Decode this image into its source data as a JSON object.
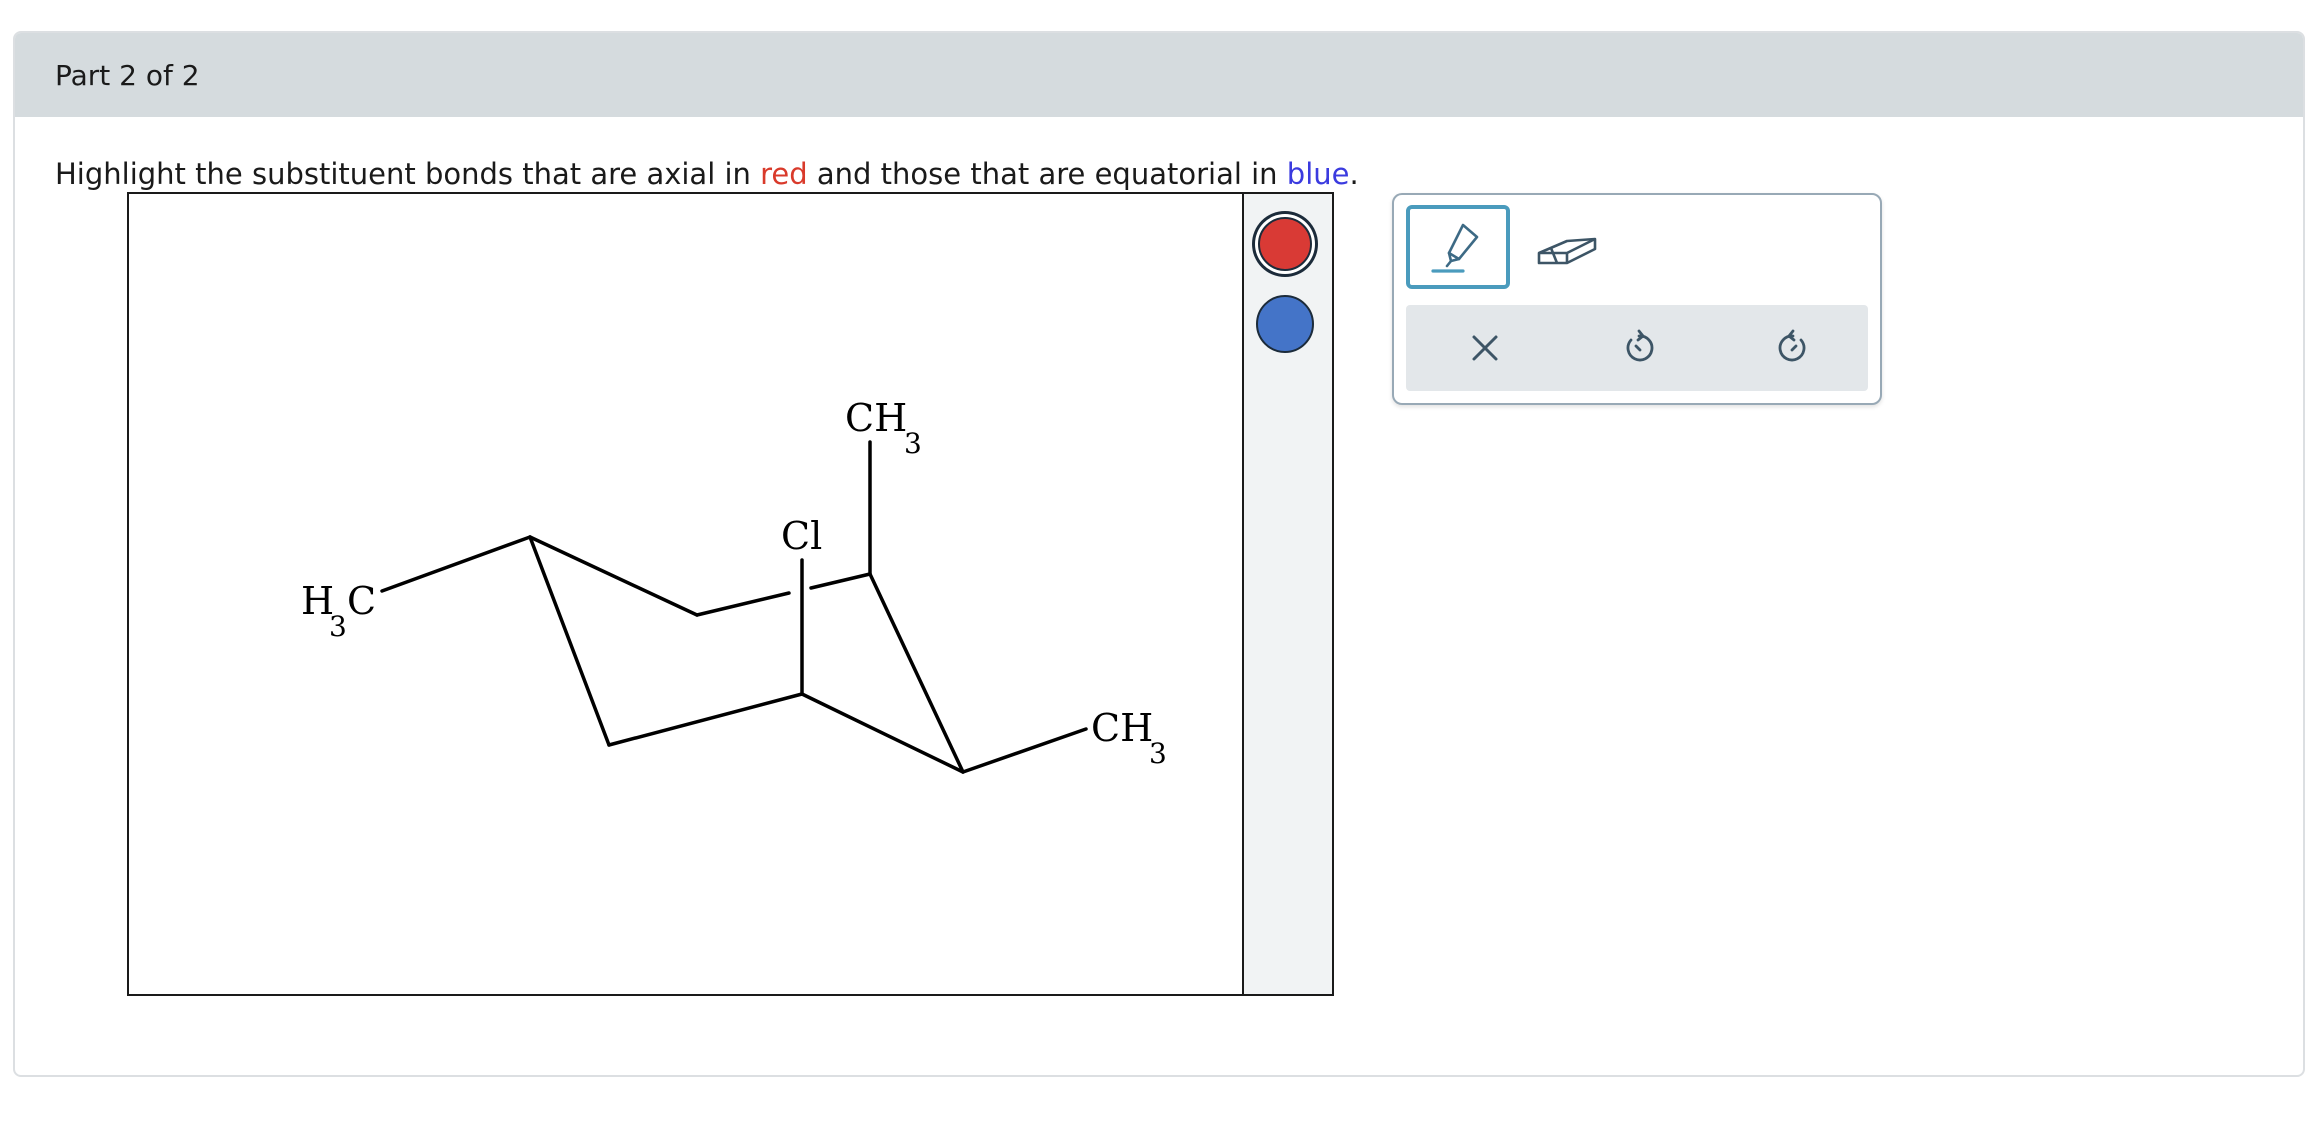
{
  "header": {
    "part_label": "Part 2 of 2"
  },
  "instruction": {
    "before": "Highlight the substituent bonds that are axial in ",
    "red_word": "red",
    "middle": " and those that are equatorial in ",
    "blue_word": "blue",
    "end": "."
  },
  "molecule": {
    "labels": {
      "h3c_h": "H",
      "h3c_sub": "3",
      "h3c_c": "C",
      "cl": "Cl",
      "ch3_top_main": "CH",
      "ch3_top_sub": "3",
      "ch3_right_main": "CH",
      "ch3_right_sub": "3"
    }
  },
  "color_picker": {
    "swatches": [
      {
        "name": "red",
        "color": "#d93a35",
        "selected": true
      },
      {
        "name": "blue",
        "color": "#4474c8",
        "selected": false
      }
    ]
  },
  "tools": {
    "pencil": {
      "icon": "highlighter-icon",
      "active": true
    },
    "eraser": {
      "icon": "eraser-icon",
      "active": false
    },
    "actions": [
      {
        "name": "clear",
        "icon": "close-icon"
      },
      {
        "name": "undo",
        "icon": "undo-icon"
      },
      {
        "name": "redo",
        "icon": "redo-icon"
      }
    ]
  },
  "colors": {
    "header_bg": "#d5dbde",
    "accent": "#4a9bbd",
    "red_text": "#d93a2b",
    "blue_text": "#3b3bdf"
  }
}
